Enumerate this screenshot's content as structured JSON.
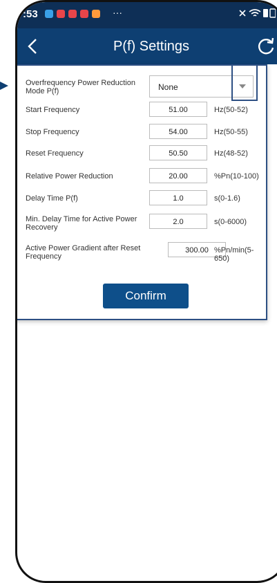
{
  "status": {
    "time": ":53",
    "more": "···",
    "icons": [
      "muted-icon",
      "wifi-icon",
      "battery-icon"
    ]
  },
  "header": {
    "title": "P(f) Settings",
    "back_icon": "chevron-left",
    "refresh_icon": "refresh"
  },
  "mode": {
    "label": "Overfrequency Power Reduction Mode P(f)",
    "value": "None"
  },
  "rows": [
    {
      "label": "Start Frequency",
      "value": "51.00",
      "unit": "Hz(50-52)"
    },
    {
      "label": "Stop Frequency",
      "value": "54.00",
      "unit": "Hz(50-55)"
    },
    {
      "label": "Reset Frequency",
      "value": "50.50",
      "unit": "Hz(48-52)"
    },
    {
      "label": "Relative Power Reduction",
      "value": "20.00",
      "unit": "%Pn(10-100)"
    },
    {
      "label": "Delay Time P(f)",
      "value": "1.0",
      "unit": "s(0-1.6)"
    },
    {
      "label": "Min. Delay Time for Active Power Recovery",
      "value": "2.0",
      "unit": "s(0-6000)"
    },
    {
      "label": "Active Power Gradient after Reset Frequency",
      "value": "300.00",
      "unit": "%Pn/min(5-650)"
    }
  ],
  "confirm_label": "Confirm",
  "colors": {
    "header": "#0e3f72",
    "status": "#0e2f56",
    "button": "#0e4f8a",
    "border": "#2d4f83"
  }
}
